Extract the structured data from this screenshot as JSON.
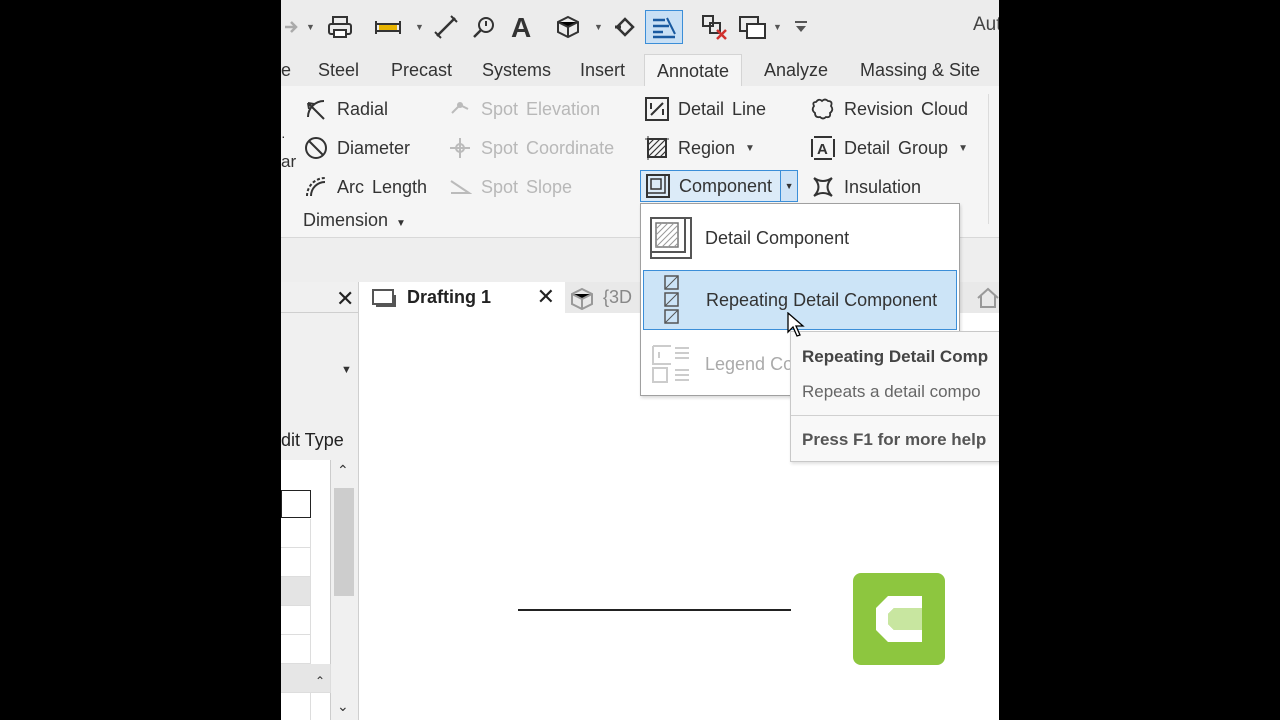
{
  "app": {
    "title": "Aut"
  },
  "tabs": [
    "e",
    "Steel",
    "Precast",
    "Systems",
    "Insert",
    "Annotate",
    "Analyze",
    "Massing & Site"
  ],
  "active_tab": "Annotate",
  "ribbon": {
    "dimension": {
      "radial": "Radial",
      "diameter": "Diameter",
      "arc_length": "Arc Length",
      "panel": "Dimension",
      "cut_text": "ar"
    },
    "spot": {
      "elevation": "Spot Elevation",
      "coordinate": "Spot Coordinate",
      "slope": "Spot Slope"
    },
    "detail": {
      "detail_line": "Detail Line",
      "region": "Region",
      "component": "Component"
    },
    "revision": {
      "revision_cloud": "Revision Cloud",
      "detail_group": "Detail Group",
      "insulation": "Insulation"
    }
  },
  "menu": {
    "items": [
      "Detail Component",
      "Repeating Detail Component",
      "Legend Co"
    ],
    "highlighted": "Repeating Detail Component"
  },
  "tooltip": {
    "title": "Repeating Detail Comp",
    "description": "Repeats a detail compo",
    "help": "Press F1 for more help"
  },
  "properties": {
    "edit_type": "dit Type"
  },
  "view_tabs": {
    "active": "Drafting 1",
    "other": "{3D"
  },
  "colors": {
    "accent": "#3b8ed8",
    "highlight": "#cce4f7",
    "logo": "#8dc63f"
  }
}
